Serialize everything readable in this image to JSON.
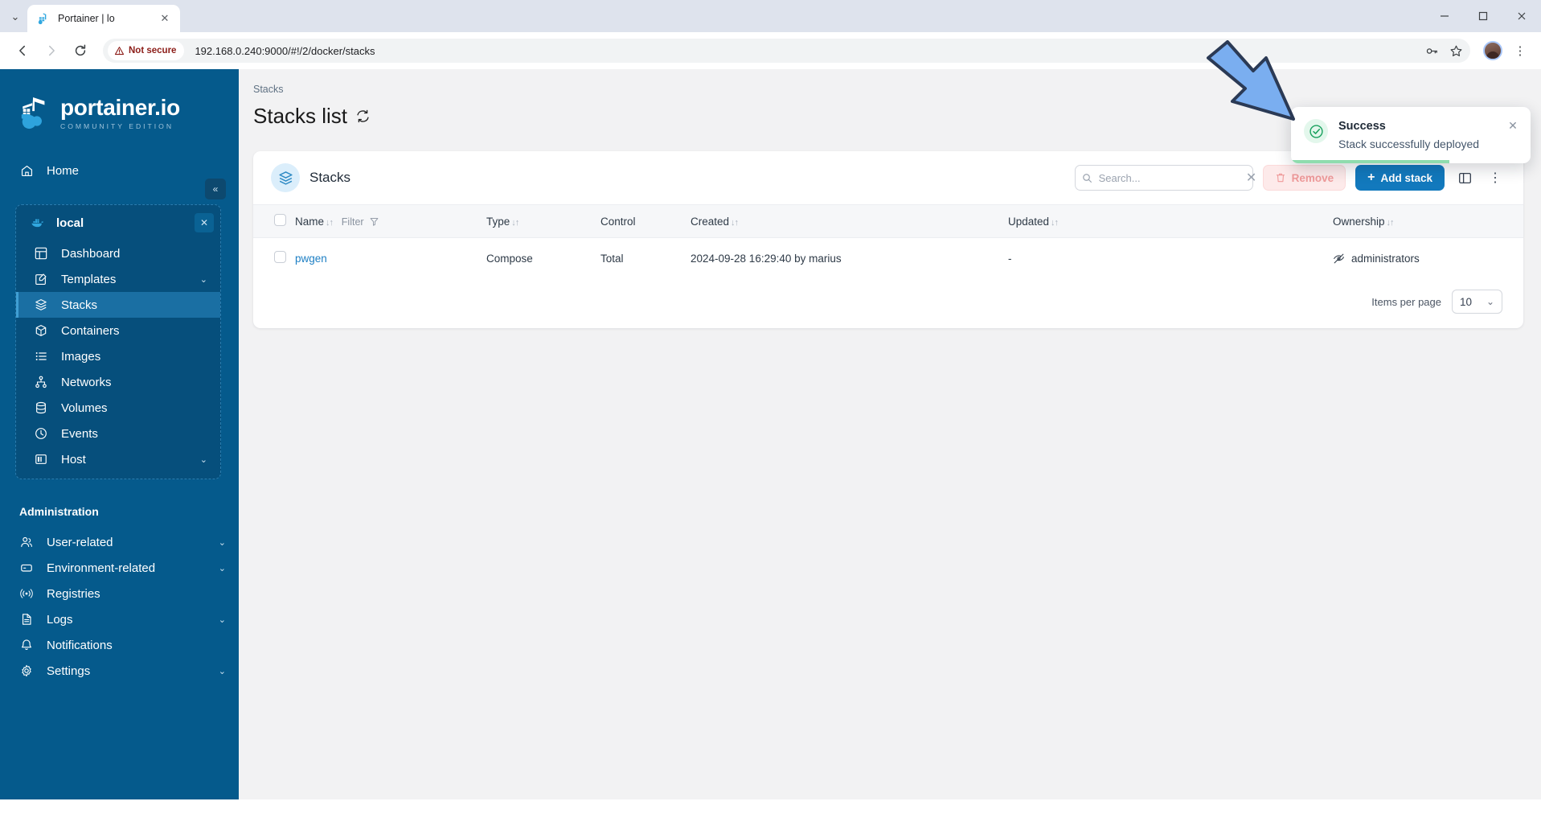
{
  "browser": {
    "tab_title": "Portainer | lo",
    "tab_close_glyph": "✕",
    "tablist_glyph": "⌄",
    "back_glyph": "←",
    "forward_glyph": "→",
    "reload_glyph": "⟳",
    "security_label": "Not secure",
    "url": "192.168.0.240:9000/#!/2/docker/stacks",
    "minimize_glyph": "—",
    "maximize_glyph": "▢",
    "close_glyph": "✕",
    "kebab_glyph": "⋮"
  },
  "sidebar": {
    "logo_title": "portainer.io",
    "logo_subtitle": "COMMUNITY EDITION",
    "collapse_glyph": "«",
    "home_label": "Home",
    "environment": {
      "name": "local",
      "close_glyph": "✕"
    },
    "env_items": [
      {
        "label": "Dashboard",
        "icon": "dashboard-icon",
        "chevron": "",
        "active": false
      },
      {
        "label": "Templates",
        "icon": "templates-icon",
        "chevron": "⌄",
        "active": false
      },
      {
        "label": "Stacks",
        "icon": "stacks-icon",
        "chevron": "",
        "active": true
      },
      {
        "label": "Containers",
        "icon": "containers-icon",
        "chevron": "",
        "active": false
      },
      {
        "label": "Images",
        "icon": "images-icon",
        "chevron": "",
        "active": false
      },
      {
        "label": "Networks",
        "icon": "networks-icon",
        "chevron": "",
        "active": false
      },
      {
        "label": "Volumes",
        "icon": "volumes-icon",
        "chevron": "",
        "active": false
      },
      {
        "label": "Events",
        "icon": "events-icon",
        "chevron": "",
        "active": false
      },
      {
        "label": "Host",
        "icon": "host-icon",
        "chevron": "⌄",
        "active": false
      }
    ],
    "admin_title": "Administration",
    "admin_items": [
      {
        "label": "User-related",
        "icon": "users-icon",
        "chevron": "⌄"
      },
      {
        "label": "Environment-related",
        "icon": "environment-icon",
        "chevron": "⌄"
      },
      {
        "label": "Registries",
        "icon": "registries-icon",
        "chevron": ""
      },
      {
        "label": "Logs",
        "icon": "logs-icon",
        "chevron": "⌄"
      },
      {
        "label": "Notifications",
        "icon": "notifications-icon",
        "chevron": ""
      },
      {
        "label": "Settings",
        "icon": "settings-icon",
        "chevron": "⌄"
      }
    ]
  },
  "main": {
    "breadcrumb": "Stacks",
    "page_title": "Stacks list",
    "card_title": "Stacks",
    "search_placeholder": "Search...",
    "search_value": "",
    "search_clear_glyph": "✕",
    "remove_label": "Remove",
    "add_stack_label": "Add stack",
    "add_stack_plus": "+",
    "columns_icon": "columns-layout-icon",
    "more_glyph": "⋮",
    "table": {
      "headers": [
        {
          "label": "Name",
          "sortable": true,
          "filter_label": "Filter"
        },
        {
          "label": "Type",
          "sortable": true
        },
        {
          "label": "Control",
          "sortable": false
        },
        {
          "label": "Created",
          "sortable": true
        },
        {
          "label": "Updated",
          "sortable": true
        },
        {
          "label": "Ownership",
          "sortable": true
        }
      ],
      "sort_arrows": "↓↑",
      "rows": [
        {
          "name": "pwgen",
          "type": "Compose",
          "control": "Total",
          "created": "2024-09-28 16:29:40 by marius",
          "updated": "-",
          "ownership": "administrators"
        }
      ]
    },
    "items_per_page_label": "Items per page",
    "items_per_page_value": "10",
    "items_per_page_chevron": "⌄"
  },
  "toast": {
    "title": "Success",
    "message": "Stack successfully deployed",
    "close_glyph": "✕",
    "accent_color": "#1aa15f",
    "progress_color": "#8fdcae"
  },
  "annotation": {
    "arrow_fill": "#7aaef0",
    "arrow_stroke": "#2b3a55"
  },
  "colors": {
    "sidebar_bg": "#055a8c",
    "primary": "#1279bd",
    "link": "#1d7fc4",
    "danger_soft": "#fdeaea"
  }
}
